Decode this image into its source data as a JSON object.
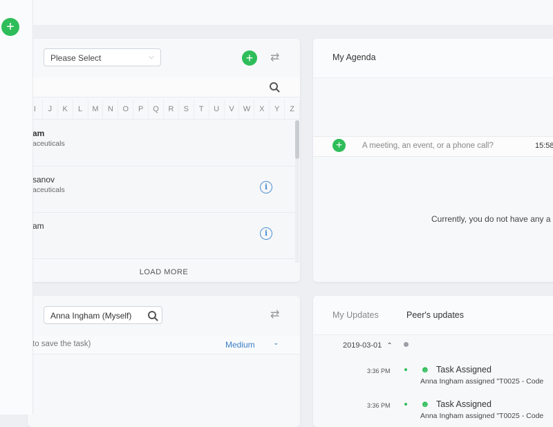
{
  "sidebar": {
    "add_label": "+"
  },
  "contacts_panel": {
    "select_placeholder": "Please Select",
    "add_label": "+",
    "letters": [
      "I",
      "J",
      "K",
      "L",
      "M",
      "N",
      "O",
      "P",
      "Q",
      "R",
      "S",
      "T",
      "U",
      "V",
      "W",
      "X",
      "Y",
      "Z"
    ],
    "contacts": [
      {
        "name": "am",
        "company": "aceuticals",
        "info": false
      },
      {
        "name": "sanov",
        "company": "aceuticals",
        "info": true
      },
      {
        "name": "am",
        "company": "",
        "info": true
      }
    ],
    "load_more": "LOAD MORE"
  },
  "agenda": {
    "title": "My Agenda",
    "placeholder": "A meeting, an event, or a phone call?",
    "time": "15:58",
    "empty_message": "Currently, you do not have any a"
  },
  "tasks_panel": {
    "assignee": "Anna Ingham (Myself)",
    "hint": "to save the task)",
    "priority": "Medium"
  },
  "updates": {
    "tab_mine": "My Updates",
    "tab_peers": "Peer's updates",
    "date": "2019-03-01",
    "items": [
      {
        "time": "3:36 PM",
        "title": "Task Assigned",
        "desc": "Anna Ingham assigned \"T0025 - Code"
      },
      {
        "time": "3:36 PM",
        "title": "Task Assigned",
        "desc": "Anna Ingham assigned \"T0025 - Code"
      }
    ]
  },
  "colors": {
    "accent_green": "#2ebd59",
    "link_blue": "#3b7fc4"
  }
}
